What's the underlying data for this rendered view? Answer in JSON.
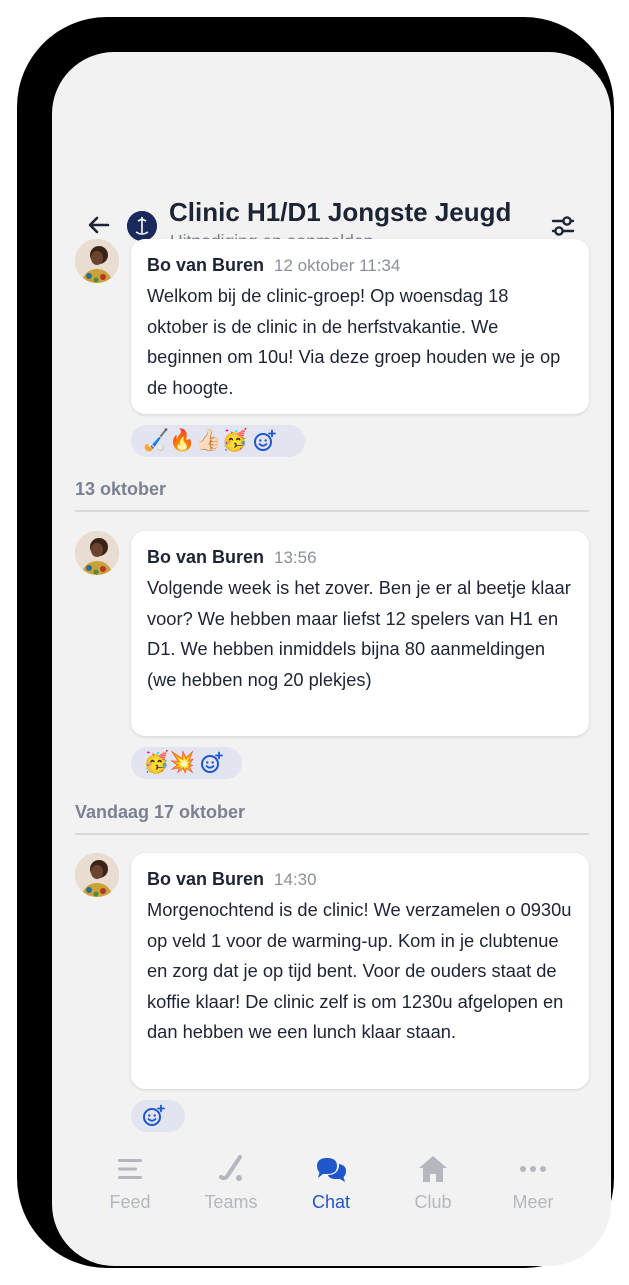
{
  "header": {
    "title": "Clinic H1/D1 Jongste Jeugd",
    "subtitle": "Uitnodiging en aanmelden"
  },
  "messages": [
    {
      "author": "Bo van Buren",
      "time": "12 oktober 11:34",
      "text": "Welkom bij de clinic-groep! Op woensdag 18 oktober is de clinic in de herfstvakantie. We beginnen om 10u! Via deze groep houden we je op de hoogte.",
      "reactions": [
        "🏑",
        "🔥",
        "👍🏻",
        "🥳"
      ]
    },
    {
      "author": "Bo van Buren",
      "time": "13:56",
      "text": "Volgende week is het zover. Ben je er al beetje klaar voor? We hebben maar liefst 12 spelers van H1 en D1. We hebben inmiddels bijna 80 aanmeldingen (we hebben nog 20 plekjes)",
      "reactions": [
        "🥳",
        "💥"
      ]
    },
    {
      "author": "Bo van Buren",
      "time": "14:30",
      "text": "Morgenochtend is de clinic! We verzamelen o 0930u op veld 1 voor de warming-up. Kom in je clubtenue en zorg dat je op tijd bent. Voor de ouders staat de koffie klaar!  De clinic zelf is om 1230u afgelopen en dan hebben we een lunch klaar staan.",
      "reactions": []
    }
  ],
  "date_separators": [
    "13 oktober",
    "Vandaag 17 oktober"
  ],
  "tabs": [
    {
      "label": "Feed",
      "icon": "feed-icon",
      "active": false
    },
    {
      "label": "Teams",
      "icon": "hockey-stick-icon",
      "active": false
    },
    {
      "label": "Chat",
      "icon": "chat-bubbles-icon",
      "active": true
    },
    {
      "label": "Club",
      "icon": "home-icon",
      "active": false
    },
    {
      "label": "Meer",
      "icon": "more-dots-icon",
      "active": false
    }
  ],
  "colors": {
    "accent": "#1f56cc",
    "background": "#f2f2f3",
    "reaction_bg": "#e2e5ef",
    "inactive_tab": "#b4b7be"
  }
}
